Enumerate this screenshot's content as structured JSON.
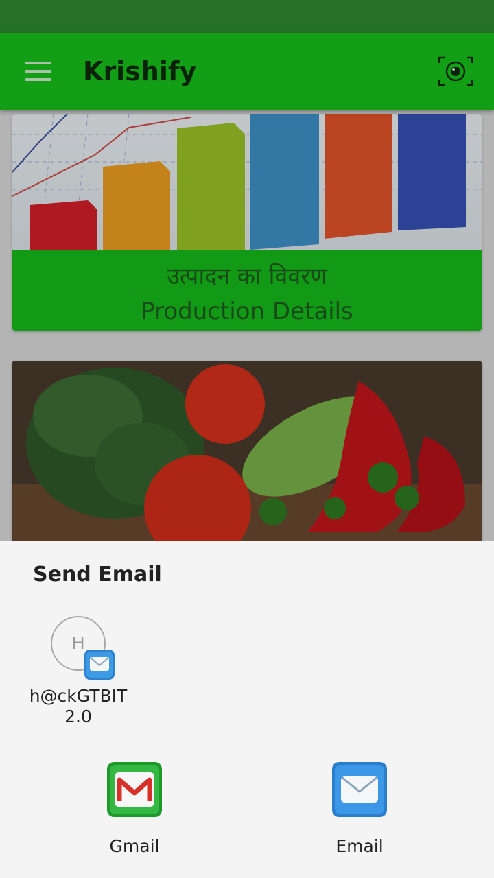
{
  "app_bar": {
    "title": "Krishify",
    "menu_icon": "hamburger-menu-icon",
    "camera_icon": "camera-scan-icon"
  },
  "cards": [
    {
      "title_hi": "उत्पादन का विवरण",
      "title_en": "Production Details",
      "image": "bar-chart-image"
    },
    {
      "image": "vegetables-image"
    }
  ],
  "share_sheet": {
    "title": "Send Email",
    "contact": {
      "initial": "H",
      "name": "h@ckGTBIT 2.0",
      "badge_icon": "email-badge-icon"
    },
    "apps": [
      {
        "label": "Gmail",
        "icon": "gmail-icon"
      },
      {
        "label": "Email",
        "icon": "email-icon"
      }
    ]
  },
  "colors": {
    "status_bar": "#2e8b2f",
    "app_bar": "#16c21b",
    "card_caption": "#17bb1c",
    "sheet_bg": "#f4f4f4"
  }
}
